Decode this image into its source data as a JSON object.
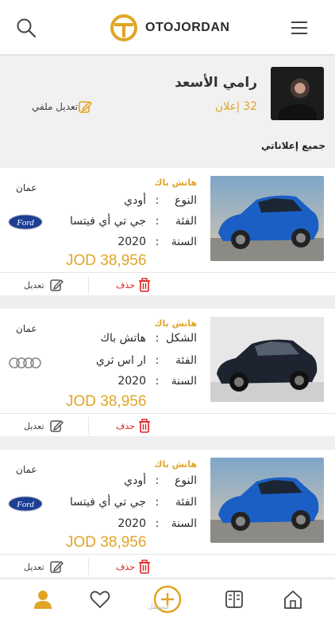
{
  "header": {
    "brand": "OTOJORDAN",
    "accent": "#e0a526"
  },
  "profile": {
    "name": "رامي الأسعد",
    "ads_count": "32 إعلان",
    "edit_label": "تعديل ملفي",
    "section_title": "جميع إعلاناتي"
  },
  "listings": [
    {
      "category": "هاتش باك",
      "rows": [
        {
          "label": "النوع",
          "sep": ":",
          "value": "أودي"
        },
        {
          "label": "الفئة",
          "sep": ":",
          "value": "جي تي أي فيتسا"
        },
        {
          "label": "السنة",
          "sep": ":",
          "value": "2020"
        }
      ],
      "price": "JOD 38,956",
      "city": "عمان",
      "brand_logo": "ford-logo",
      "car_color": "blue",
      "edit_label": "تعديل",
      "delete_label": "حذف"
    },
    {
      "category": "هاتش باك",
      "rows": [
        {
          "label": "الشكل",
          "sep": ":",
          "value": "هاتش باك"
        },
        {
          "label": "الفئة",
          "sep": ":",
          "value": "ار اس ثري"
        },
        {
          "label": "السنة",
          "sep": ":",
          "value": "2020"
        }
      ],
      "price": "JOD 38,956",
      "city": "عمان",
      "brand_logo": "audi-logo",
      "car_color": "black",
      "edit_label": "تعديل",
      "delete_label": "حذف"
    },
    {
      "category": "هاتش باك",
      "rows": [
        {
          "label": "النوع",
          "sep": ":",
          "value": "أودي"
        },
        {
          "label": "الفئة",
          "sep": ":",
          "value": "جي تي أي فيتسا"
        },
        {
          "label": "السنة",
          "sep": ":",
          "value": "2020"
        }
      ],
      "price": "JOD 38,956",
      "city": "عمان",
      "brand_logo": "ford-logo",
      "car_color": "blue",
      "edit_label": "تعديل",
      "delete_label": "حذف"
    }
  ],
  "bottom_nav": [
    "profile-icon",
    "heart-icon",
    "add-icon",
    "catalog-icon",
    "home-icon"
  ],
  "watermark": "مستقل"
}
